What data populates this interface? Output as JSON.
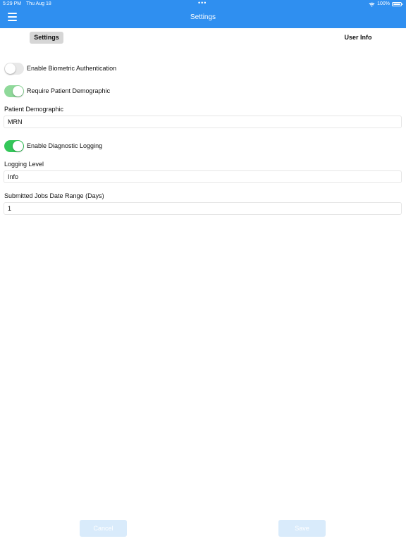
{
  "status_bar": {
    "time": "5:29 PM",
    "date": "Thu Aug 18",
    "dots": "•••",
    "battery": "100%"
  },
  "header": {
    "title": "Settings",
    "menu_icon": "hamburger-menu-icon",
    "color": "#2f8ff0"
  },
  "tabs": [
    {
      "label": "Settings",
      "selected": true
    },
    {
      "label": "User Info",
      "selected": false
    }
  ],
  "settings": {
    "biometric": {
      "label": "Enable Biometric Authentication",
      "on": false
    },
    "require_demographic": {
      "label": "Require Patient Demographic",
      "on": true,
      "disabled": true
    },
    "patient_demographic": {
      "label": "Patient Demographic",
      "value": "MRN"
    },
    "diagnostic_logging": {
      "label": "Enable Diagnostic Logging",
      "on": true
    },
    "logging_level": {
      "label": "Logging Level",
      "value": "Info"
    },
    "date_range": {
      "label": "Submitted Jobs Date Range (Days)",
      "value": "1"
    }
  },
  "actions": {
    "cancel_label": "Cancel",
    "save_label": "Save"
  }
}
